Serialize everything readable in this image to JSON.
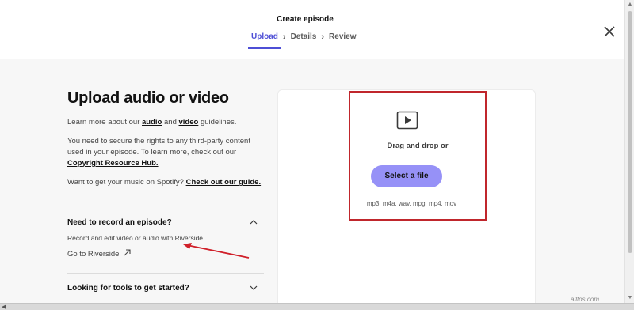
{
  "header": {
    "title": "Create episode",
    "steps": [
      {
        "label": "Upload",
        "active": true
      },
      {
        "label": "Details",
        "active": false
      },
      {
        "label": "Review",
        "active": false
      }
    ],
    "step_separator_icon": "chevron-right-icon",
    "close_icon": "close-icon"
  },
  "left": {
    "title": "Upload audio or video",
    "guidelines": {
      "prefix": "Learn more about our ",
      "audio_link": "audio",
      "middle": " and ",
      "video_link": "video",
      "suffix": " guidelines."
    },
    "rights": {
      "text": "You need to secure the rights to any third-party content used in your episode. To learn more, check out our ",
      "link": "Copyright Resource Hub."
    },
    "music": {
      "text": "Want to get your music on Spotify? ",
      "link": "Check out our guide."
    },
    "record_section": {
      "heading": "Need to record an episode?",
      "description": "Record and edit video or audio with Riverside.",
      "link": "Go to Riverside",
      "link_icon": "external-arrow-icon",
      "expanded": true
    },
    "tools_section": {
      "heading": "Looking for tools to get started?",
      "expanded": false
    }
  },
  "upload": {
    "icon": "video-play-icon",
    "drop_text": "Drag and drop or",
    "button_label": "Select a file",
    "formats": "mp3, m4a, wav, mpg, mp4, mov"
  },
  "colors": {
    "accent": "#4e4fd6",
    "button": "#9691f7",
    "highlight_box": "#c0262c",
    "annotation_arrow": "#d0202a"
  },
  "watermark": "allfds.com"
}
